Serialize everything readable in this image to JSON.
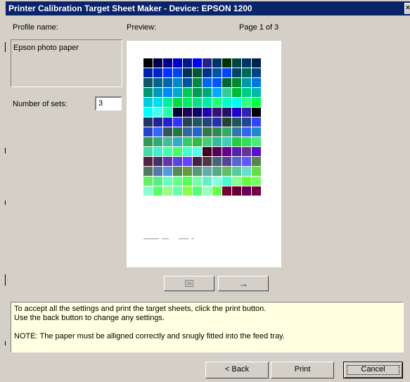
{
  "window": {
    "title": "Printer Calibration Target Sheet Maker - Device: EPSON 1200",
    "close_glyph": "×"
  },
  "labels": {
    "profile_name": "Profile name:",
    "preview": "Preview:",
    "page_indicator": "Page 1 of 3",
    "number_of_sets": "Number of sets:"
  },
  "profile": {
    "value": "Epson photo paper"
  },
  "sets": {
    "value": "3"
  },
  "nav": {
    "back_icon": "back-page-icon",
    "forward_icon": "right-arrow-icon",
    "forward_glyph": "→"
  },
  "info": {
    "line1": "To accept all the settings and print the target sheets, click the print button.",
    "line2": "Use the back button to change any settings.",
    "line3": "NOTE: The paper must be alligned correctly and snugly fitted into the feed tray."
  },
  "buttons": {
    "back": "< Back",
    "print": "Print",
    "cancel": "Cancel"
  },
  "preview_grid": {
    "rows": [
      [
        "#000000",
        "#00004a",
        "#000088",
        "#0000cc",
        "#001a88",
        "#0000ff",
        "#222288",
        "#003366",
        "#003300",
        "#004444",
        "#003366",
        "#002244"
      ],
      [
        "#0022aa",
        "#0022cc",
        "#0033ff",
        "#0044ee",
        "#003355",
        "#005533",
        "#003388",
        "#0055aa",
        "#0044ff",
        "#004466",
        "#006655",
        "#004488"
      ],
      [
        "#115566",
        "#006688",
        "#0066aa",
        "#0088cc",
        "#005599",
        "#008844",
        "#0066ee",
        "#0055ff",
        "#006633",
        "#008833",
        "#0099aa",
        "#0077dd"
      ],
      [
        "#009977",
        "#0099bb",
        "#0088ff",
        "#00aacc",
        "#00cc55",
        "#009955",
        "#00aa77",
        "#00aaff",
        "#33cc99",
        "#00bb33",
        "#00cc88",
        "#00bbaa"
      ],
      [
        "#00ccdd",
        "#00ddee",
        "#00ee99",
        "#00dd44",
        "#00ee66",
        "#11dd88",
        "#00eeaa",
        "#22ff77",
        "#00ffcc",
        "#00ffee",
        "#33ff88",
        "#00ff44"
      ],
      [
        "#00ffff",
        "#44ffee",
        "#22ffaa",
        "#000033",
        "#220055",
        "#110066",
        "#2200aa",
        "#331177",
        "#221166",
        "#2200cc",
        "#3322aa",
        "#000000"
      ],
      [
        "#223366",
        "#222299",
        "#2222cc",
        "#3333ff",
        "#224455",
        "#225566",
        "#224477",
        "#2233aa",
        "#224433",
        "#225555",
        "#224499",
        "#3344ff"
      ],
      [
        "#2244cc",
        "#3366ff",
        "#335555",
        "#227744",
        "#336699",
        "#2266cc",
        "#337744",
        "#338855",
        "#33aa66",
        "#3377aa",
        "#3366ee",
        "#2288cc"
      ],
      [
        "#339955",
        "#33aa77",
        "#44bb99",
        "#33aacc",
        "#33cc66",
        "#33bb44",
        "#44cc77",
        "#33bb99",
        "#44ccbb",
        "#22cc44",
        "#33dd55",
        "#44ee77"
      ],
      [
        "#44ddaa",
        "#44eecc",
        "#44ffaa",
        "#44ff66",
        "#44ffcc",
        "#55ffee",
        "#440022",
        "#550055",
        "#660088",
        "#5522aa",
        "#663399",
        "#5511cc"
      ],
      [
        "#552244",
        "#443366",
        "#6633aa",
        "#5544dd",
        "#6644ff",
        "#442244",
        "#553344",
        "#446677",
        "#554499",
        "#5566cc",
        "#6655ff",
        "#558844"
      ],
      [
        "#557766",
        "#5577aa",
        "#5599dd",
        "#558855",
        "#669944",
        "#559977",
        "#66aaaa",
        "#55aa88",
        "#66bb66",
        "#55cc99",
        "#66ddcc",
        "#66dd44"
      ],
      [
        "#66ee66",
        "#55ee88",
        "#66ffbb",
        "#66ff88",
        "#55ff55",
        "#77ffaa",
        "#66eecc",
        "#88ffdd",
        "#44ffcc",
        "#88ff99",
        "#66ff44",
        "#77ff66"
      ],
      [
        "#88ffcc",
        "#55ff66",
        "#99ff88",
        "#66ffaa",
        "#88ff44",
        "#55ff77",
        "#99ffbb",
        "#66ff55",
        "#770033",
        "#660033",
        "#660055",
        "#770044"
      ]
    ]
  }
}
